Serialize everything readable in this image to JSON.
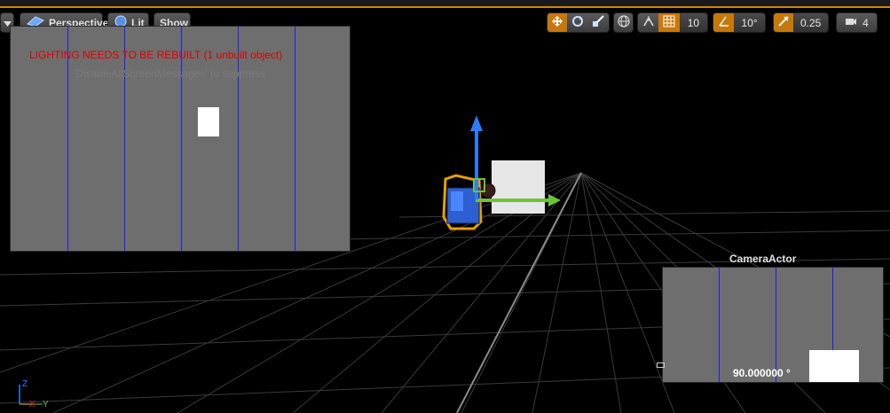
{
  "toolbar": {
    "menu_icon": "dropdown-caret-icon",
    "perspective_label": "Perspective",
    "lit_label": "Lit",
    "show_label": "Show",
    "grid_snap_value": "10",
    "rotation_snap_value": "10°",
    "scale_snap_value": "0.25",
    "camera_speed_value": "4"
  },
  "messages": {
    "lighting_warning": "LIGHTING NEEDS TO BE REBUILT (1 unbuilt object)",
    "suppress_hint": "'DisableAllScreenMessages' to suppress"
  },
  "camera_preview": {
    "title": "CameraActor",
    "fov_readout": "90.000000 °"
  },
  "axis": {
    "z": "Z",
    "x": "X",
    "y": "Y"
  },
  "colors": {
    "accent": "#c8780a",
    "warning": "#e00000",
    "preview_bg": "#6e6e6e",
    "line_blue": "#1c1cff"
  }
}
